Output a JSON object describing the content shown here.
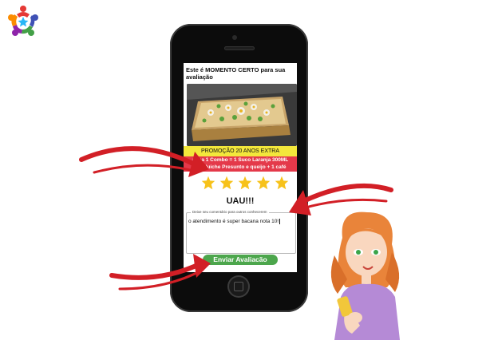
{
  "colors": {
    "promo_bg": "#f3e73b",
    "promo_desc_bg": "#e4394a",
    "star": "#f7c21a",
    "submit_bg": "#4ca64c",
    "arrow": "#d21f26"
  },
  "screen": {
    "heading": "Este é MOMENTO CERTO para sua avaliação",
    "promo_title": "PROMOÇÃO 20 ANOS EXTRA",
    "promo_desc": "anha 1 Combo = 1 Suco Laranja 300ML Sanduiche Presunto e queijo + 1 café",
    "rating": {
      "value": 5,
      "max": 5
    },
    "rating_word": "UAU!!!",
    "comment_label": "Deixe seu comentário para outros conhecerem",
    "comment_value": "o atendimento é super bacana nota 10!",
    "submit_label": "Enviar Avaliacão"
  },
  "icons": {
    "logo": "people-circle-logo",
    "camera": "front-camera-icon",
    "home": "home-button-icon",
    "stars": "star-icon"
  }
}
